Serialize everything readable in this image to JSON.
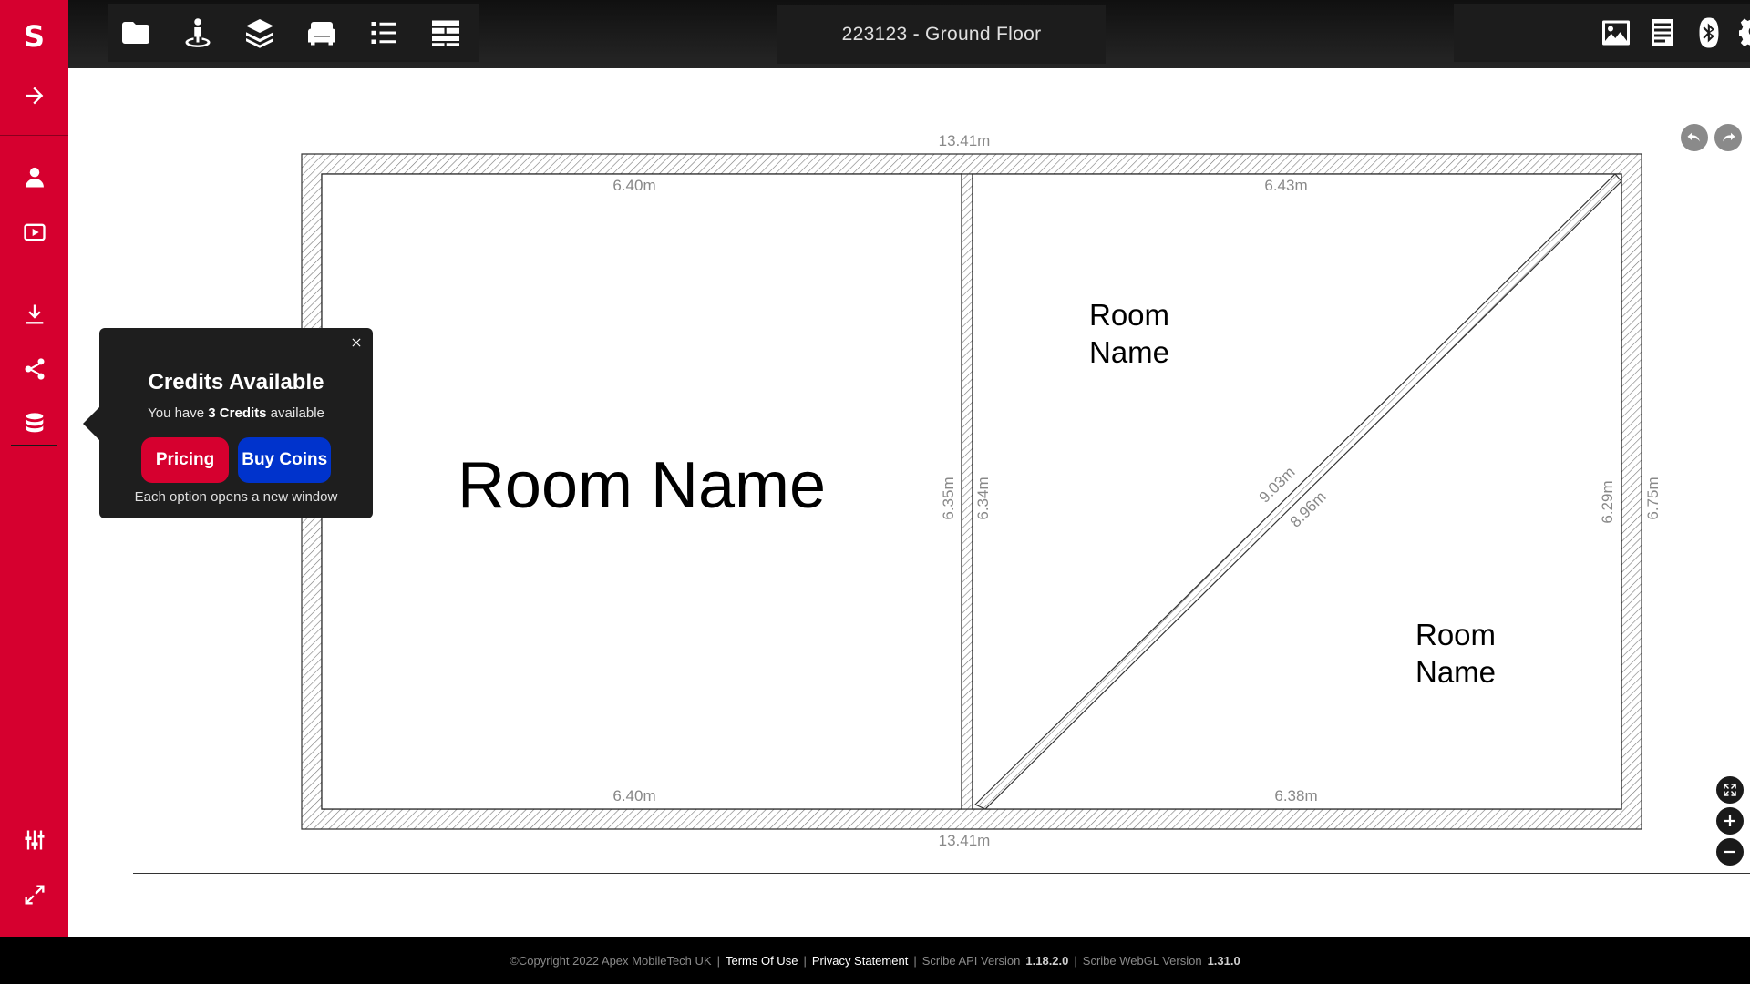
{
  "app": {
    "logo": "S",
    "title": "223123 - Ground Floor",
    "accent_color": "#d6002f"
  },
  "sidebar": {
    "items": [
      {
        "name": "arrow-right-icon"
      },
      {
        "name": "user-icon"
      },
      {
        "name": "video-play-icon"
      },
      {
        "name": "download-icon"
      },
      {
        "name": "share-icon"
      },
      {
        "name": "database-icon"
      },
      {
        "name": "sliders-icon"
      },
      {
        "name": "expand-icon"
      }
    ]
  },
  "toolbar": {
    "left_tools": [
      "folder-icon",
      "person-pin-icon",
      "layers-icon",
      "sofa-icon",
      "list-icon",
      "wall-icon"
    ],
    "right_tools": [
      "image-icon",
      "document-icon",
      "bluetooth-icon",
      "gear-icon"
    ]
  },
  "floorplan": {
    "dimensions": {
      "top_outer": "13.41m",
      "bottom_outer": "13.41m",
      "room1_top": "6.40m",
      "room1_bottom": "6.40m",
      "room1_right": "6.35m",
      "room2_top": "6.43m",
      "room2_bottom": "6.38m",
      "room2_left": "6.34m",
      "room2_right_inner": "6.29m",
      "right_outer": "6.75m",
      "diag_a": "9.03m",
      "diag_b": "8.96m"
    },
    "rooms": {
      "room1_label": "Room Name",
      "room2_label_line1": "Room",
      "room2_label_line2": "Name",
      "room3_label_line1": "Room",
      "room3_label_line2": "Name"
    }
  },
  "credits_popup": {
    "title": "Credits Available",
    "sub_prefix": "You have",
    "credits_count": "3 Credits",
    "sub_suffix": "available",
    "pricing_label": "Pricing",
    "buy_label": "Buy Coins",
    "note": "Each option opens a new window"
  },
  "footer": {
    "copyright": "©Copyright 2022 Apex MobileTech UK",
    "sep": "|",
    "terms": "Terms Of Use",
    "privacy": "Privacy Statement",
    "api_label": "Scribe API Version",
    "api_version": "1.18.2.0",
    "webgl_label": "Scribe WebGL Version",
    "webgl_version": "1.31.0"
  }
}
